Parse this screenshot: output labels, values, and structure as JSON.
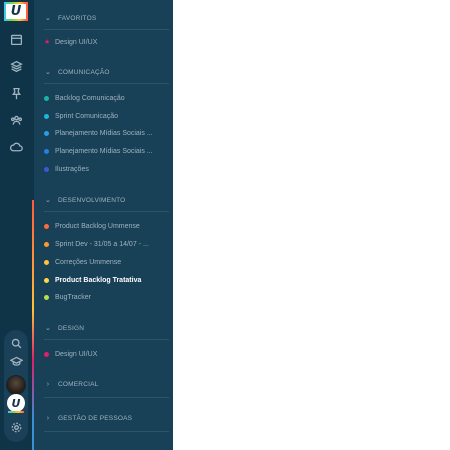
{
  "brand": {
    "logo_letter": "U"
  },
  "rail": {
    "icons": [
      "calendar-icon",
      "layers-icon",
      "pin-icon",
      "team-icon",
      "cloud-icon"
    ],
    "bottom_icons": [
      "search-icon",
      "graduation-cap-icon",
      "gear-icon"
    ]
  },
  "sections": {
    "favoritos": {
      "title": "FAVORITOS",
      "items": [
        {
          "label": "Design UI/UX",
          "color": "#e01f6b",
          "marker": "star"
        }
      ]
    },
    "comunicacao": {
      "title": "COMUNICAÇÃO",
      "items": [
        {
          "label": "Backlog Comunicação",
          "color": "#1ab3a6"
        },
        {
          "label": "Sprint Comunicação",
          "color": "#1fb6e0"
        },
        {
          "label": "Planejamento Mídias Sociais ...",
          "color": "#2a9be6"
        },
        {
          "label": "Planejamento Mídias Sociais ...",
          "color": "#2380e0"
        },
        {
          "label": "Ilustrações",
          "color": "#3a5bd0"
        }
      ]
    },
    "desenvolvimento": {
      "title": "DESENVOLVIMENTO",
      "items": [
        {
          "label": "Product Backlog Ummense",
          "color": "#ff6a3a"
        },
        {
          "label": "Sprint Dev - 31/05 a 14/07 - ...",
          "color": "#ff9a2a"
        },
        {
          "label": "Correções Ummense",
          "color": "#ffc23a"
        },
        {
          "label": "Product Backlog Tratativa",
          "color": "#ffd84a",
          "active": true
        },
        {
          "label": "BugTracker",
          "color": "#b8e04a"
        }
      ]
    },
    "design": {
      "title": "DESIGN",
      "items": [
        {
          "label": "Design UI/UX",
          "color": "#e01f6b"
        }
      ]
    },
    "comercial": {
      "title": "COMERCIAL",
      "items": []
    },
    "gestao": {
      "title": "GESTÃO DE PESSOAS",
      "items": []
    }
  }
}
